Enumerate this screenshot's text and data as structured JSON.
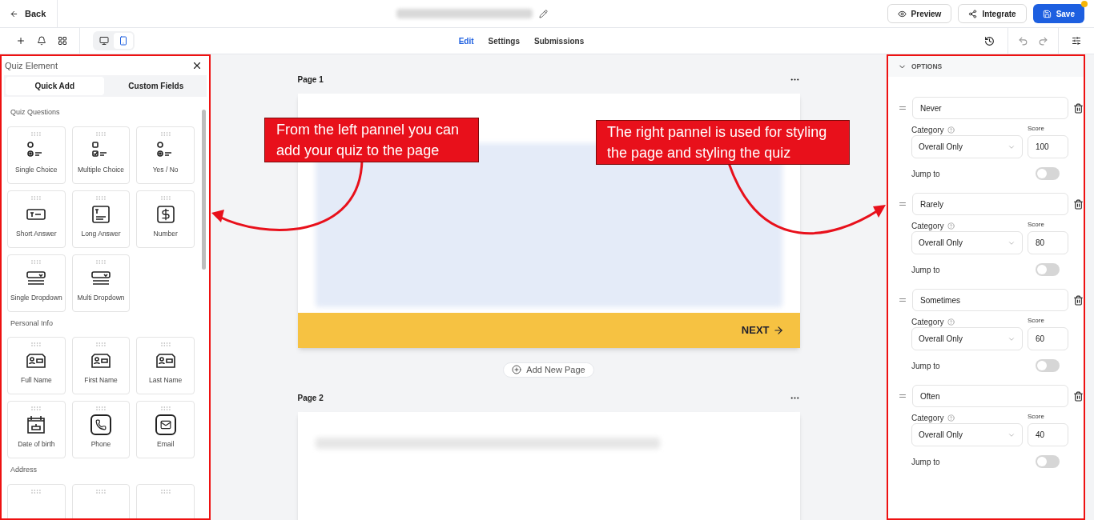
{
  "top_bar": {
    "back": "Back",
    "actions": [
      {
        "label": "Preview",
        "kind": "preview"
      },
      {
        "label": "Integrate",
        "kind": "integrate"
      },
      {
        "label": "Save",
        "kind": "save"
      }
    ]
  },
  "toolbar": {
    "devices": [
      {
        "kind": "desktop",
        "selected": false
      },
      {
        "kind": "mobile",
        "selected": true
      }
    ],
    "tabs": [
      {
        "label": "Edit",
        "selected": true
      },
      {
        "label": "Settings",
        "selected": false
      },
      {
        "label": "Submissions",
        "selected": false
      }
    ]
  },
  "left_panel": {
    "title": "Quiz Element",
    "tabs": [
      {
        "label": "Quick Add",
        "selected": true
      },
      {
        "label": "Custom Fields",
        "selected": false
      }
    ],
    "sections": [
      {
        "title": "Quiz Questions",
        "items": [
          {
            "label": "Single Choice",
            "kind": "single_choice"
          },
          {
            "label": "Multiple Choice",
            "kind": "multiple_choice"
          },
          {
            "label": "Yes / No",
            "kind": "single_choice"
          },
          {
            "label": "Short Answer",
            "kind": "short_answer"
          },
          {
            "label": "Long Answer",
            "kind": "long_answer"
          },
          {
            "label": "Number",
            "kind": "number"
          },
          {
            "label": "Single Dropdown",
            "kind": "dropdown"
          },
          {
            "label": "Multi Dropdown",
            "kind": "dropdown"
          }
        ]
      },
      {
        "title": "Personal Info",
        "items": [
          {
            "label": "Full Name",
            "kind": "name_card"
          },
          {
            "label": "First Name",
            "kind": "name_card"
          },
          {
            "label": "Last Name",
            "kind": "name_card"
          },
          {
            "label": "Date of birth",
            "kind": "cake"
          },
          {
            "label": "Phone",
            "kind": "phone"
          },
          {
            "label": "Email",
            "kind": "email"
          }
        ]
      },
      {
        "title": "Address",
        "items": [
          {
            "kind": "blank"
          },
          {
            "kind": "blank"
          },
          {
            "kind": "blank"
          }
        ]
      }
    ]
  },
  "canvas": {
    "pages": [
      {
        "label": "Page 1",
        "button": "NEXT"
      },
      {
        "label": "Page 2"
      }
    ],
    "add_page": "Add New Page"
  },
  "right_panel": {
    "header": "OPTIONS",
    "options": [
      {
        "label": "Never",
        "category_label": "Category",
        "category": "Overall Only",
        "score_label": "Score",
        "score": "100",
        "jump_label": "Jump to",
        "jump_to": false
      },
      {
        "label": "Rarely",
        "category_label": "Category",
        "category": "Overall Only",
        "score_label": "Score",
        "score": "80",
        "jump_label": "Jump to",
        "jump_to": false
      },
      {
        "label": "Sometimes",
        "category_label": "Category",
        "category": "Overall Only",
        "score_label": "Score",
        "score": "60",
        "jump_label": "Jump to",
        "jump_to": false
      },
      {
        "label": "Often",
        "category_label": "Category",
        "category": "Overall Only",
        "score_label": "Score",
        "score": "40",
        "jump_label": "Jump to",
        "jump_to": false
      }
    ]
  },
  "callouts": [
    {
      "text": "From the left pannel you can add your quiz to the page"
    },
    {
      "text": "The right pannel is used for styling the page and styling the quiz"
    }
  ]
}
